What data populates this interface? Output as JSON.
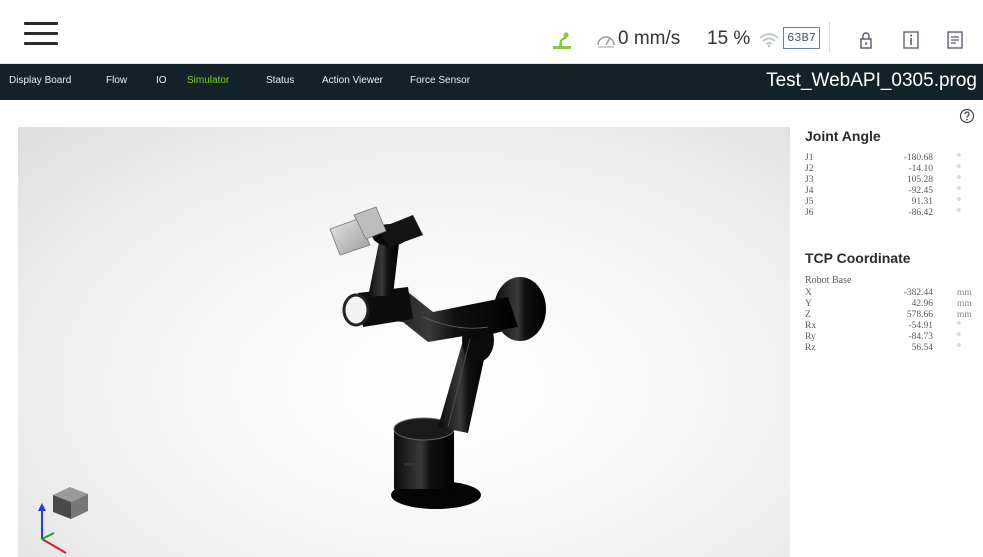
{
  "toolbar": {
    "speed": "0 mm/s",
    "percentage": "15 %",
    "ip_suffix": "63B7",
    "colors": {
      "robot_status": "#8cc63f",
      "ip_border": "#6b7f8c"
    },
    "icons": [
      "menu-icon",
      "robot-status-icon",
      "speed-icon",
      "wifi-icon",
      "lock-icon",
      "info-icon",
      "document-icon"
    ]
  },
  "nav": {
    "tabs": [
      {
        "label": "Display Board"
      },
      {
        "label": "Flow"
      },
      {
        "label": "IO"
      },
      {
        "label": "Simulator",
        "active": true
      },
      {
        "label": "Status"
      },
      {
        "label": "Action Viewer"
      },
      {
        "label": "Force Sensor"
      }
    ],
    "project_name": "Test_WebAPI_0305.prog",
    "active_color": "#7ed321"
  },
  "joint_angle": {
    "title": "Joint Angle",
    "rows": [
      {
        "label": "J1",
        "value": "-180.68",
        "unit": "°"
      },
      {
        "label": "J2",
        "value": "-14.10",
        "unit": "°"
      },
      {
        "label": "J3",
        "value": "105.28",
        "unit": "°"
      },
      {
        "label": "J4",
        "value": "-92.45",
        "unit": "°"
      },
      {
        "label": "J5",
        "value": "91.31",
        "unit": "°"
      },
      {
        "label": "J6",
        "value": "-86.42",
        "unit": "°"
      }
    ]
  },
  "tcp": {
    "title": "TCP Coordinate",
    "frame": "Robot Base",
    "rows": [
      {
        "label": "X",
        "value": "-382.44",
        "unit": "mm"
      },
      {
        "label": "Y",
        "value": "42.96",
        "unit": "mm"
      },
      {
        "label": "Z",
        "value": "578.66",
        "unit": "mm"
      },
      {
        "label": "Rx",
        "value": "-54.91",
        "unit": "°"
      },
      {
        "label": "Ry",
        "value": "-84.73",
        "unit": "°"
      },
      {
        "label": "Rz",
        "value": "56.54",
        "unit": "°"
      }
    ]
  }
}
